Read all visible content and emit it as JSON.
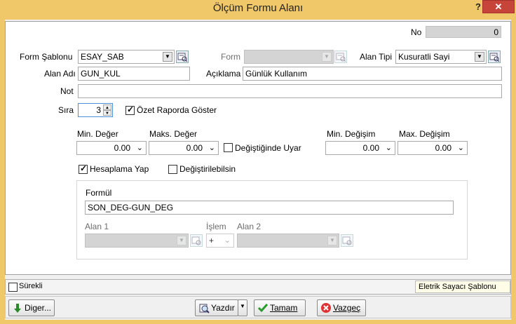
{
  "window": {
    "title": "Ölçüm Formu Alanı",
    "help": "?",
    "close": "✕"
  },
  "no": {
    "label": "No",
    "value": "0"
  },
  "form_sablonu": {
    "label": "Form Şablonu",
    "value": "ESAY_SAB"
  },
  "form": {
    "label": "Form",
    "value": ""
  },
  "alan_tipi": {
    "label": "Alan Tipi",
    "value": "Kusuratli Sayi"
  },
  "alan_adi": {
    "label": "Alan Adı",
    "value": "GUN_KUL"
  },
  "aciklama": {
    "label": "Açıklama",
    "value": "Günlük Kullanım"
  },
  "not": {
    "label": "Not",
    "value": ""
  },
  "sira": {
    "label": "Sıra",
    "value": "3"
  },
  "ozet": {
    "label": "Özet Raporda Göster",
    "checked": true
  },
  "min_deger": {
    "label": "Min. Değer",
    "value": "0.00"
  },
  "maks_deger": {
    "label": "Maks. Değer",
    "value": "0.00"
  },
  "degistiginde_uyar": {
    "label": "Değiştiğinde Uyar",
    "checked": false
  },
  "min_degisim": {
    "label": "Min. Değişim",
    "value": "0.00"
  },
  "max_degisim": {
    "label": "Max. Değişim",
    "value": "0.00"
  },
  "hesaplama": {
    "label": "Hesaplama Yap",
    "checked": true
  },
  "degistirilebilsin": {
    "label": "Değiştirilebilsin",
    "checked": false
  },
  "formul": {
    "label": "Formül",
    "value": "SON_DEG-GUN_DEG",
    "alan1_label": "Alan 1",
    "islem_label": "İşlem",
    "islem_value": "+",
    "alan2_label": "Alan 2"
  },
  "status": {
    "surekli_label": "Sürekli",
    "surekli_checked": false,
    "template_name": "Eletrik Sayacı Şablonu"
  },
  "buttons": {
    "diger": "Diger...",
    "yazdir": "Yazdır",
    "tamam": "Tamam",
    "vazgec": "Vazgeç"
  },
  "colors": {
    "titlebar": "#f0c869",
    "close": "#c7443b",
    "disabled": "#d4d4d4"
  }
}
